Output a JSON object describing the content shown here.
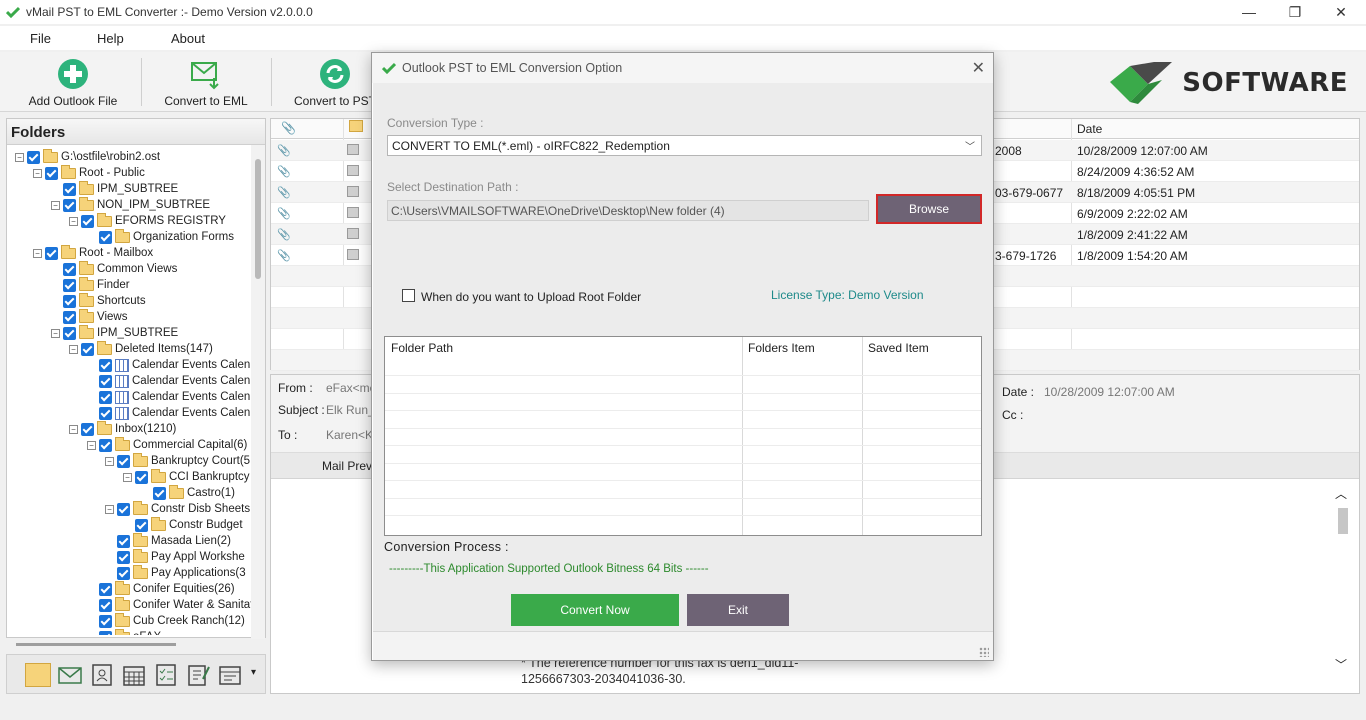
{
  "window": {
    "title": "vMail PST to EML Converter :- Demo Version v2.0.0.0",
    "minimize": "—",
    "maximize": "❐",
    "close": "✕"
  },
  "menu": {
    "file": "File",
    "help": "Help",
    "about": "About"
  },
  "toolbar": {
    "add_outlook_file": "Add Outlook File",
    "convert_to_eml": "Convert to EML",
    "convert_to_pst": "Convert to PST"
  },
  "logo": {
    "text": "SOFTWARE"
  },
  "folders": {
    "header": "Folders",
    "items": [
      {
        "label": "G:\\ostfile\\robin2.ost",
        "level": 0,
        "exp": "−",
        "icon": "folder"
      },
      {
        "label": "Root - Public",
        "level": 1,
        "exp": "−",
        "icon": "folder"
      },
      {
        "label": "IPM_SUBTREE",
        "level": 2,
        "exp": "",
        "icon": "folder"
      },
      {
        "label": "NON_IPM_SUBTREE",
        "level": 2,
        "exp": "−",
        "icon": "folder"
      },
      {
        "label": "EFORMS REGISTRY",
        "level": 3,
        "exp": "−",
        "icon": "folder"
      },
      {
        "label": "Organization Forms",
        "level": 4,
        "exp": "",
        "icon": "folder"
      },
      {
        "label": "Root - Mailbox",
        "level": 1,
        "exp": "−",
        "icon": "folder"
      },
      {
        "label": "Common Views",
        "level": 2,
        "exp": "",
        "icon": "folder"
      },
      {
        "label": "Finder",
        "level": 2,
        "exp": "",
        "icon": "folder"
      },
      {
        "label": "Shortcuts",
        "level": 2,
        "exp": "",
        "icon": "folder"
      },
      {
        "label": "Views",
        "level": 2,
        "exp": "",
        "icon": "folder"
      },
      {
        "label": "IPM_SUBTREE",
        "level": 2,
        "exp": "−",
        "icon": "folder"
      },
      {
        "label": "Deleted Items(147)",
        "level": 3,
        "exp": "−",
        "icon": "folder"
      },
      {
        "label": "Calendar Events Calen",
        "level": 4,
        "exp": "",
        "icon": "calendar"
      },
      {
        "label": "Calendar Events Calen",
        "level": 4,
        "exp": "",
        "icon": "calendar"
      },
      {
        "label": "Calendar Events Calen",
        "level": 4,
        "exp": "",
        "icon": "calendar"
      },
      {
        "label": "Calendar Events Calen",
        "level": 4,
        "exp": "",
        "icon": "calendar"
      },
      {
        "label": "Inbox(1210)",
        "level": 3,
        "exp": "−",
        "icon": "folder"
      },
      {
        "label": "Commercial Capital(6)",
        "level": 4,
        "exp": "−",
        "icon": "folder"
      },
      {
        "label": "Bankruptcy Court(5",
        "level": 5,
        "exp": "−",
        "icon": "folder"
      },
      {
        "label": "CCI Bankruptcy",
        "level": 6,
        "exp": "−",
        "icon": "folder"
      },
      {
        "label": "Castro(1)",
        "level": 7,
        "exp": "",
        "icon": "folder"
      },
      {
        "label": "Constr Disb Sheets",
        "level": 5,
        "exp": "−",
        "icon": "folder"
      },
      {
        "label": "Constr Budget",
        "level": 6,
        "exp": "",
        "icon": "folder"
      },
      {
        "label": "Masada Lien(2)",
        "level": 5,
        "exp": "",
        "icon": "folder"
      },
      {
        "label": "Pay Appl Workshe",
        "level": 5,
        "exp": "",
        "icon": "folder"
      },
      {
        "label": "Pay Applications(3",
        "level": 5,
        "exp": "",
        "icon": "folder"
      },
      {
        "label": "Conifer Equities(26)",
        "level": 4,
        "exp": "",
        "icon": "folder"
      },
      {
        "label": "Conifer Water & Sanitat",
        "level": 4,
        "exp": "",
        "icon": "folder"
      },
      {
        "label": "Cub Creek Ranch(12)",
        "level": 4,
        "exp": "",
        "icon": "folder"
      },
      {
        "label": "eFAX",
        "level": 4,
        "exp": "",
        "icon": "folder"
      }
    ]
  },
  "maillist": {
    "date_header": "Date",
    "rows": [
      {
        "from": "2008",
        "date": "10/28/2009 12:07:00 AM"
      },
      {
        "from": "",
        "date": "8/24/2009 4:36:52 AM"
      },
      {
        "from": "03-679-0677",
        "date": "8/18/2009 4:05:51 PM"
      },
      {
        "from": "",
        "date": "6/9/2009 2:22:02 AM"
      },
      {
        "from": "",
        "date": "1/8/2009 2:41:22 AM"
      },
      {
        "from": "3-679-1726",
        "date": "1/8/2009 1:54:20 AM"
      }
    ]
  },
  "detail": {
    "from_label": "From :",
    "from_value": "eFax<mes",
    "subject_label": "Subject :",
    "subject_value": "Elk Run_C",
    "to_label": "To :",
    "to_value": "Karen<Ka",
    "date_label": "Date :",
    "date_value": "10/28/2009 12:07:00 AM",
    "cc_label": "Cc :",
    "preview_tab": "Mail Previe",
    "body_line1": "* The reference number for this fax is den1_did11-",
    "body_line2": "1256667303-2034041036-30."
  },
  "dialog": {
    "title": "Outlook PST to EML Conversion Option",
    "close": "✕",
    "conversion_type_label": "Conversion Type :",
    "conversion_type_value": "CONVERT TO EML(*.eml) - oIRFC822_Redemption",
    "destination_label": "Select Destination Path :",
    "destination_value": "C:\\Users\\VMAILSOFTWARE\\OneDrive\\Desktop\\New folder (4)",
    "browse": "Browse",
    "upload_root_label": "When do you want to Upload Root Folder",
    "license": "License Type: Demo Version",
    "grid_headers": [
      "Folder Path",
      "Folders Item",
      "Saved Item"
    ],
    "conversion_process_label": "Conversion Process :",
    "conversion_message": "---------This Application Supported Outlook Bitness 64 Bits  ------",
    "convert_now": "Convert Now",
    "exit": "Exit"
  },
  "colors": {
    "accent_green": "#3aaa4a",
    "button_purple": "#6e6375",
    "highlight_red": "#d22828",
    "checkbox_blue": "#1a73d9",
    "license_teal": "#1e8a8a"
  }
}
